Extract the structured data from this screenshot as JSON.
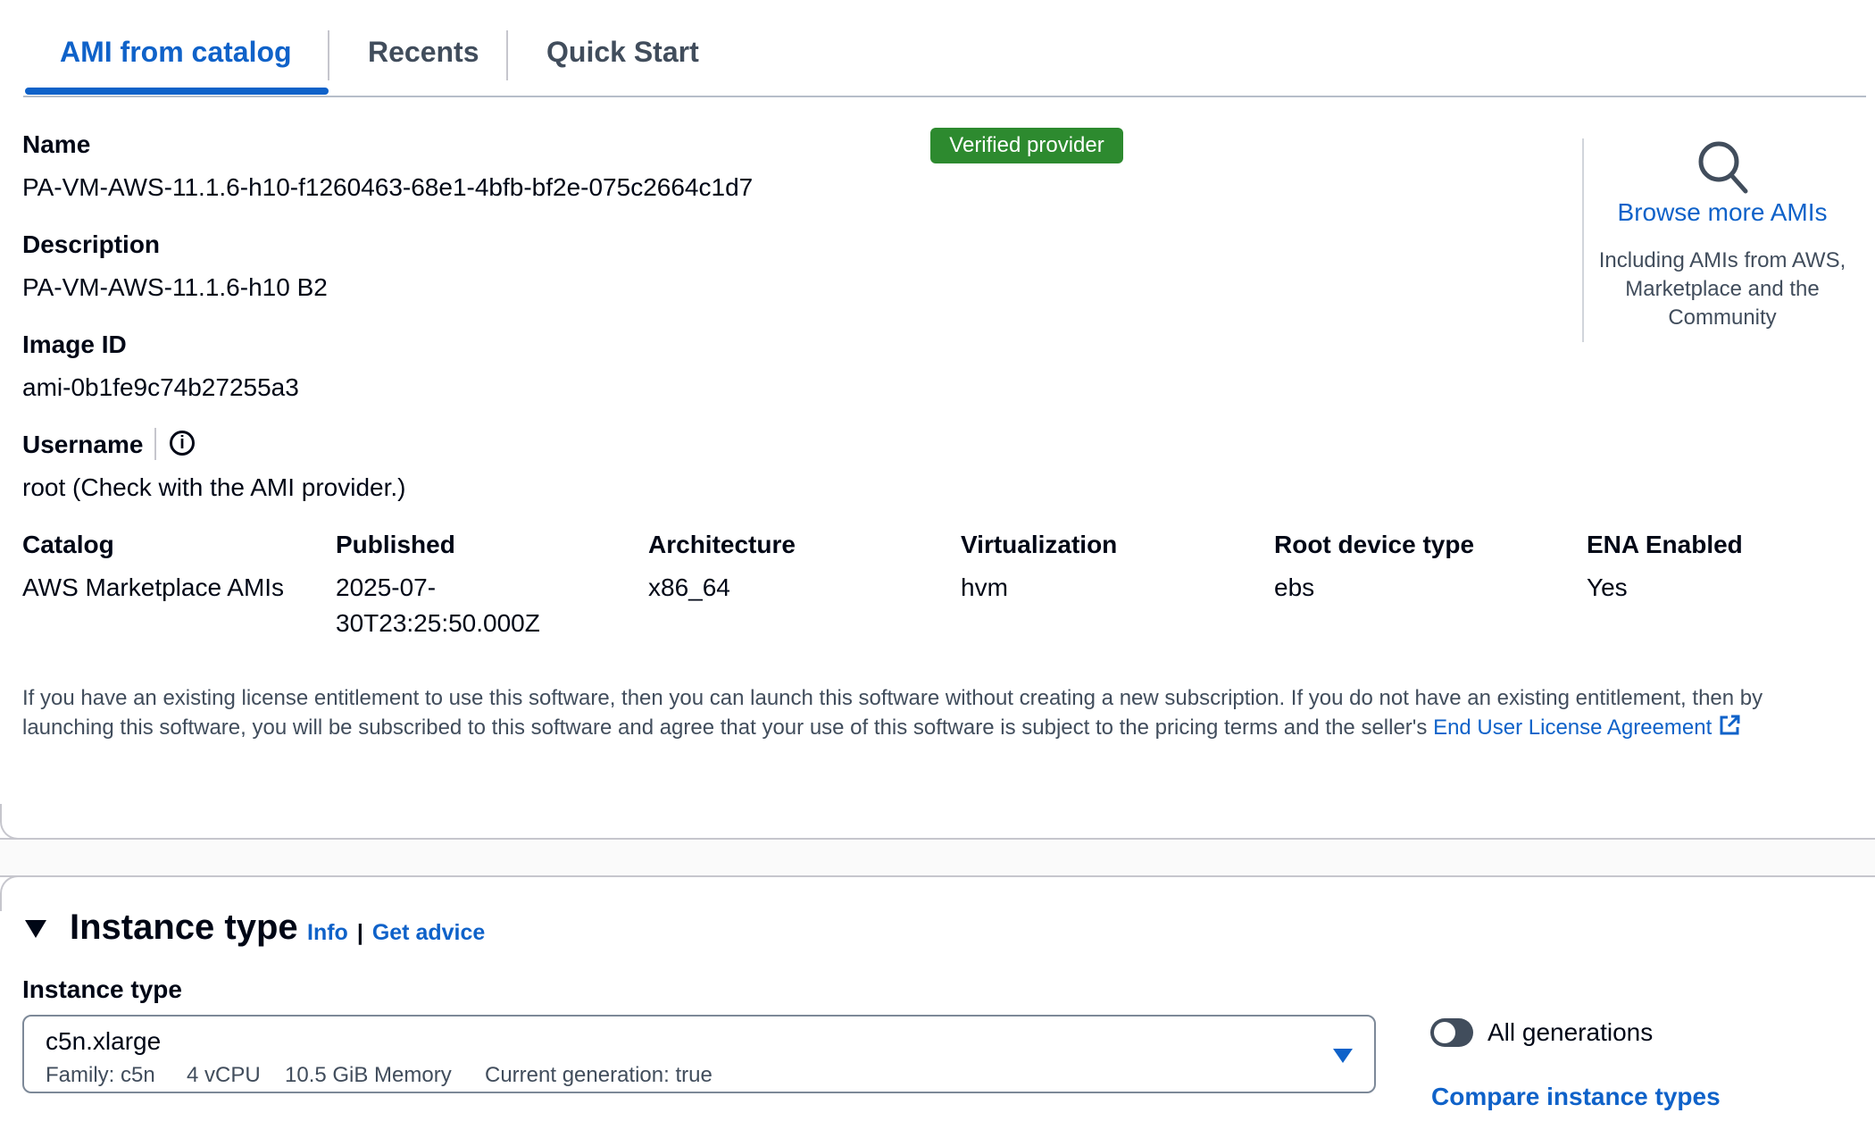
{
  "tabs": [
    {
      "label": "AMI from catalog",
      "active": true
    },
    {
      "label": "Recents",
      "active": false
    },
    {
      "label": "Quick Start",
      "active": false
    }
  ],
  "ami": {
    "name_label": "Name",
    "name_value": "PA-VM-AWS-11.1.6-h10-f1260463-68e1-4bfb-bf2e-075c2664c1d7",
    "verified_badge": "Verified provider",
    "description_label": "Description",
    "description_value": "PA-VM-AWS-11.1.6-h10 B2",
    "image_id_label": "Image ID",
    "image_id_value": "ami-0b1fe9c74b27255a3",
    "username_label": "Username",
    "username_value": "root (Check with the AMI provider.)"
  },
  "details": {
    "catalog_label": "Catalog",
    "catalog_value": "AWS Marketplace AMIs",
    "published_label": "Published",
    "published_value_line1": "2025-07-",
    "published_value_line2": "30T23:25:50.000Z",
    "architecture_label": "Architecture",
    "architecture_value": "x86_64",
    "virtualization_label": "Virtualization",
    "virtualization_value": "hvm",
    "root_device_label": "Root device type",
    "root_device_value": "ebs",
    "ena_label": "ENA Enabled",
    "ena_value": "Yes"
  },
  "browse": {
    "title": "Browse more AMIs",
    "description": "Including AMIs from AWS, Marketplace and the Community"
  },
  "license": {
    "text": "If you have an existing license entitlement to use this software, then you can launch this software without creating a new subscription. If you do not have an existing entitlement, then by launching this software, you will be subscribed to this software and agree that your use of this software is subject to the pricing terms and the seller's ",
    "link": "End User License Agreement"
  },
  "instance_type": {
    "section_title": "Instance type",
    "info_link": "Info",
    "separator": "|",
    "advice_link": "Get advice",
    "field_label": "Instance type",
    "selected": "c5n.xlarge",
    "family": "Family: c5n",
    "vcpu": "4 vCPU",
    "memory": "10.5 GiB Memory",
    "generation": "Current generation: true",
    "toggle_label": "All generations",
    "toggle_on": false,
    "compare_link": "Compare instance types"
  },
  "colors": {
    "accent": "#0f62c9",
    "badge": "#2d8a2f",
    "text": "#000716",
    "secondary_text": "#414d5c"
  },
  "icons": {
    "search": "search-icon",
    "info": "info-icon",
    "external": "external-link-icon",
    "collapse": "caret-down-icon",
    "dropdown": "dropdown-caret-icon"
  }
}
